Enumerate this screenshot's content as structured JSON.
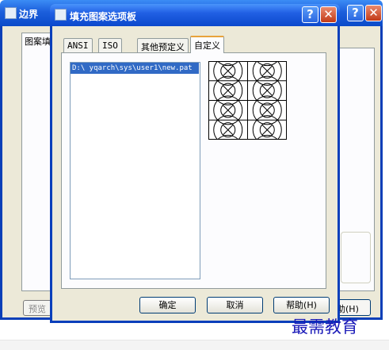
{
  "background_dialog": {
    "title": "边界",
    "tab_label": "图案填",
    "preview_button": "预览",
    "help_button_partial": "助(H)"
  },
  "dialog": {
    "title": "填充图案选项板",
    "tabs": [
      {
        "label": "ANSI",
        "selected": false
      },
      {
        "label": "ISO",
        "selected": false
      },
      {
        "label": "其他预定义",
        "selected": false
      },
      {
        "label": "自定义",
        "selected": true
      }
    ],
    "file_list": {
      "items": [
        "D:\\ yqarch\\sys\\user1\\new.pat"
      ],
      "selected_index": 0
    },
    "pattern_preview_icon": "circle-cross-hatch-pattern",
    "buttons": {
      "ok": "确定",
      "cancel": "取消",
      "help": "帮助(H)"
    }
  },
  "watermark": "最需教育",
  "colors": {
    "titlebar_blue": "#0a4ac9",
    "dialog_face": "#ece9d8",
    "selection": "#316ac5",
    "close_red": "#c23a17",
    "tab_highlight": "#e8a33b",
    "watermark": "#1a1ab8"
  }
}
